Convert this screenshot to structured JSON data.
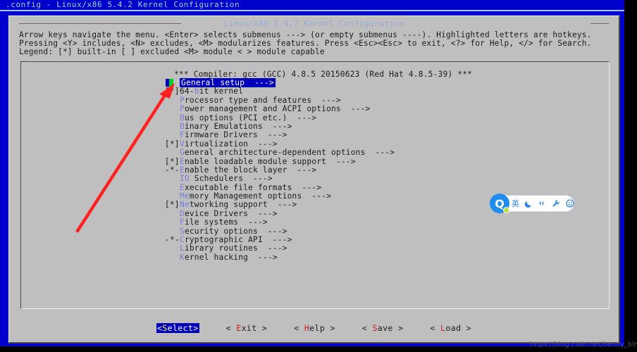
{
  "window": {
    "titlebar": ".config - Linux/x86 5.4.2 Kernel Configuration",
    "dialog_title": "Linux/x86 5.4.2 Kernel Configuration",
    "title_color": "#8fd8e8",
    "frame_color": "#0000cc",
    "dialog_bg": "#bfbfbf"
  },
  "help": {
    "line1": "Arrow keys navigate the menu.  <Enter> selects submenus ---> (or empty submenus ----).  Highlighted letters are hotkeys.",
    "line2": "Pressing <Y> includes, <N> excludes, <M> modularizes features.  Press <Esc><Esc> to exit, <?> for Help, </> for Search.",
    "line3": "Legend: [*] built-in  [ ] excluded  <M> module  < > module capable"
  },
  "menu": {
    "compiler_line": "*** Compiler: gcc (GCC) 4.8.5 20150623 (Red Hat 4.8.5-39) ***",
    "selected_index": 0,
    "highlight_bg": "#0000bb",
    "hotkey_color": "#7b7bd8",
    "items": [
      {
        "mark": "",
        "pre": "",
        "hot": "G",
        "post": "eneral setup",
        "suffix": "  --->",
        "selected": true
      },
      {
        "mark": "[*]",
        "pre": "64-",
        "hot": "b",
        "post": "it kernel",
        "suffix": "",
        "selected": false
      },
      {
        "mark": "",
        "pre": "",
        "hot": "P",
        "post": "rocessor type and features",
        "suffix": "  --->",
        "selected": false
      },
      {
        "mark": "",
        "pre": "",
        "hot": "P",
        "post": "ower management and ACPI options",
        "suffix": "  --->",
        "selected": false
      },
      {
        "mark": "",
        "pre": "",
        "hot": "B",
        "post": "us options (PCI etc.)",
        "suffix": "  --->",
        "selected": false
      },
      {
        "mark": "",
        "pre": "",
        "hot": "B",
        "post": "inary Emulations",
        "suffix": "  --->",
        "selected": false
      },
      {
        "mark": "",
        "pre": "",
        "hot": "F",
        "post": "irmware Drivers",
        "suffix": "  --->",
        "selected": false
      },
      {
        "mark": "[*]",
        "pre": "",
        "hot": "V",
        "post": "irtualization",
        "suffix": "  --->",
        "selected": false
      },
      {
        "mark": "",
        "pre": "",
        "hot": "G",
        "post": "eneral architecture-dependent options",
        "suffix": "  --->",
        "selected": false
      },
      {
        "mark": "[*]",
        "pre": "",
        "hot": "E",
        "post": "nable loadable module support",
        "suffix": "  --->",
        "selected": false
      },
      {
        "mark": "-*-",
        "pre": "",
        "hot": "E",
        "post": "nable the block layer",
        "suffix": "  --->",
        "selected": false
      },
      {
        "mark": "",
        "pre": "",
        "hot": "IO",
        "post": " Schedulers",
        "suffix": "  --->",
        "selected": false
      },
      {
        "mark": "",
        "pre": "",
        "hot": "E",
        "post": "xecutable file formats",
        "suffix": "  --->",
        "selected": false
      },
      {
        "mark": "",
        "pre": "",
        "hot": "Me",
        "post": "mory Management options",
        "suffix": "  --->",
        "selected": false
      },
      {
        "mark": "[*]",
        "pre": "",
        "hot": "Ne",
        "post": "tworking support",
        "suffix": "  --->",
        "selected": false
      },
      {
        "mark": "",
        "pre": "",
        "hot": "D",
        "post": "evice Drivers",
        "suffix": "  --->",
        "selected": false
      },
      {
        "mark": "",
        "pre": "",
        "hot": "F",
        "post": "ile systems",
        "suffix": "  --->",
        "selected": false
      },
      {
        "mark": "",
        "pre": "",
        "hot": "S",
        "post": "ecurity options",
        "suffix": "  --->",
        "selected": false
      },
      {
        "mark": "-*-",
        "pre": "",
        "hot": "C",
        "post": "ryptographic API",
        "suffix": "  --->",
        "selected": false
      },
      {
        "mark": "",
        "pre": "",
        "hot": "L",
        "post": "ibrary routines",
        "suffix": "  --->",
        "selected": false
      },
      {
        "mark": "",
        "pre": "",
        "hot": "K",
        "post": "ernel hacking",
        "suffix": "  --->",
        "selected": false
      }
    ]
  },
  "buttons": [
    {
      "name": "select",
      "open": "<",
      "key": "S",
      "rest": "elect",
      "close": ">",
      "active": true
    },
    {
      "name": "exit",
      "open": "< ",
      "key": "E",
      "rest": "xit",
      "close": " >",
      "active": false
    },
    {
      "name": "help",
      "open": "< ",
      "key": "H",
      "rest": "elp",
      "close": " >",
      "active": false
    },
    {
      "name": "save",
      "open": "< ",
      "key": "S",
      "rest": "ave",
      "close": " >",
      "active": false
    },
    {
      "name": "load",
      "open": "< ",
      "key": "L",
      "rest": "oad",
      "close": " >",
      "active": false
    }
  ],
  "annotation": {
    "arrow_color": "#ff2020",
    "arrow_note": "red arrow pointing to General setup row"
  },
  "ime": {
    "logo_letter": "Q",
    "mode_label": "英",
    "moon_icon": "☽",
    "quote_icon": "”",
    "wrench_icon": "ὒ7",
    "smiley_icon": "☺",
    "grid_icon": "grid",
    "accent_color": "#2f86f0",
    "dot_color": "#b9e03a"
  },
  "watermark": {
    "text": "https://blog.csdn.net/benny_bln"
  }
}
